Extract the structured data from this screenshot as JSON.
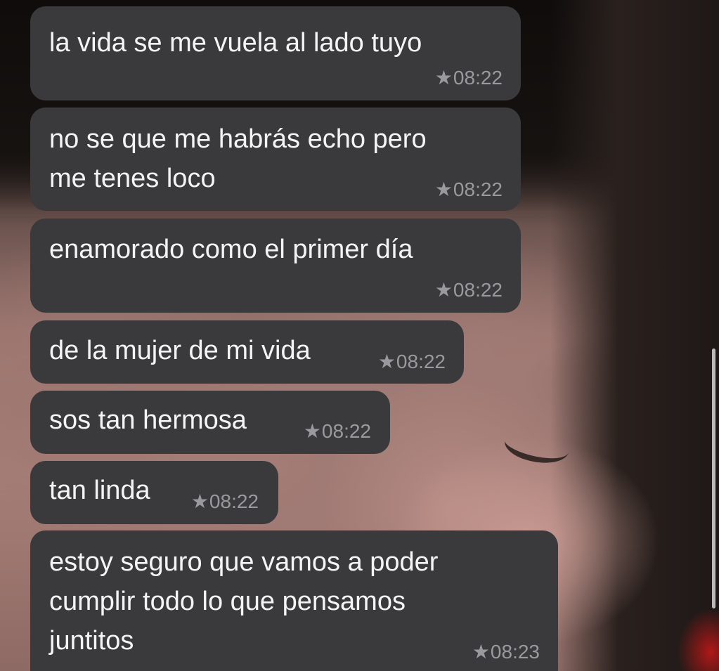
{
  "messages": [
    {
      "text": "la vida se me vuela al lado tuyo",
      "time": "08:22",
      "starred": "★"
    },
    {
      "text": "no se que me habrás echo pero\nme tenes loco",
      "time": "08:22",
      "starred": "★"
    },
    {
      "text": "enamorado como el primer día",
      "time": "08:22",
      "starred": "★"
    },
    {
      "text": "de la mujer de mi vida",
      "time": "08:22",
      "starred": "★"
    },
    {
      "text": "sos tan hermosa",
      "time": "08:22",
      "starred": "★"
    },
    {
      "text": "tan linda",
      "time": "08:22",
      "starred": "★"
    },
    {
      "text": "estoy seguro que vamos a poder\ncumplir todo lo que pensamos\njuntitos",
      "time": "08:23",
      "starred": "★"
    }
  ],
  "colors": {
    "bubble": "#3a3a3c",
    "text": "#f4f4f4",
    "meta": "#9a9a9e"
  },
  "icons": {
    "starred": "star-icon"
  }
}
